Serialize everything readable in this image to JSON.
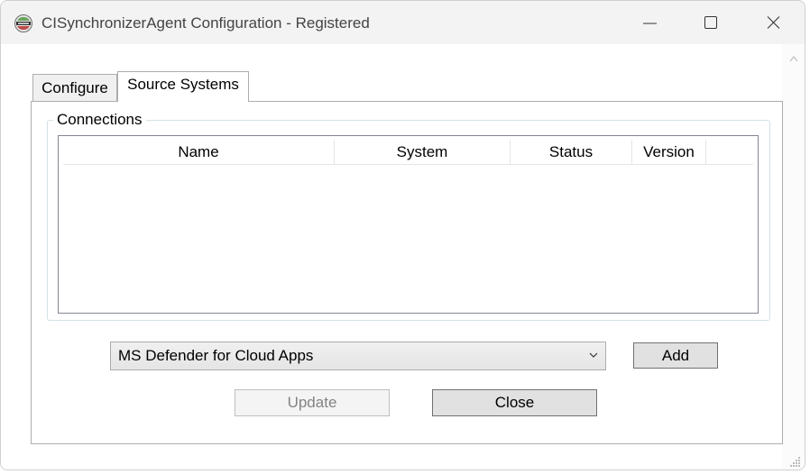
{
  "window": {
    "title": "CISynchronizerAgent Configuration - Registered",
    "app_icon": "synchronizer-logo-icon"
  },
  "window_controls": {
    "minimize_icon": "minimize-icon",
    "maximize_icon": "maximize-icon",
    "close_icon": "close-icon"
  },
  "tabs": [
    {
      "label": "Configure",
      "active": false
    },
    {
      "label": "Source Systems",
      "active": true
    }
  ],
  "connections": {
    "group_label": "Connections",
    "columns": [
      "Name",
      "System",
      "Status",
      "Version"
    ],
    "rows": []
  },
  "source_select": {
    "selected": "MS Defender for Cloud Apps",
    "arrow_icon": "chevron-down-icon"
  },
  "buttons": {
    "add": "Add",
    "update": "Update",
    "update_enabled": false,
    "close": "Close"
  },
  "colors": {
    "titlebar_bg": "#f3f3f3",
    "button_bg": "#e1e1e1",
    "disabled_text": "#838383"
  }
}
